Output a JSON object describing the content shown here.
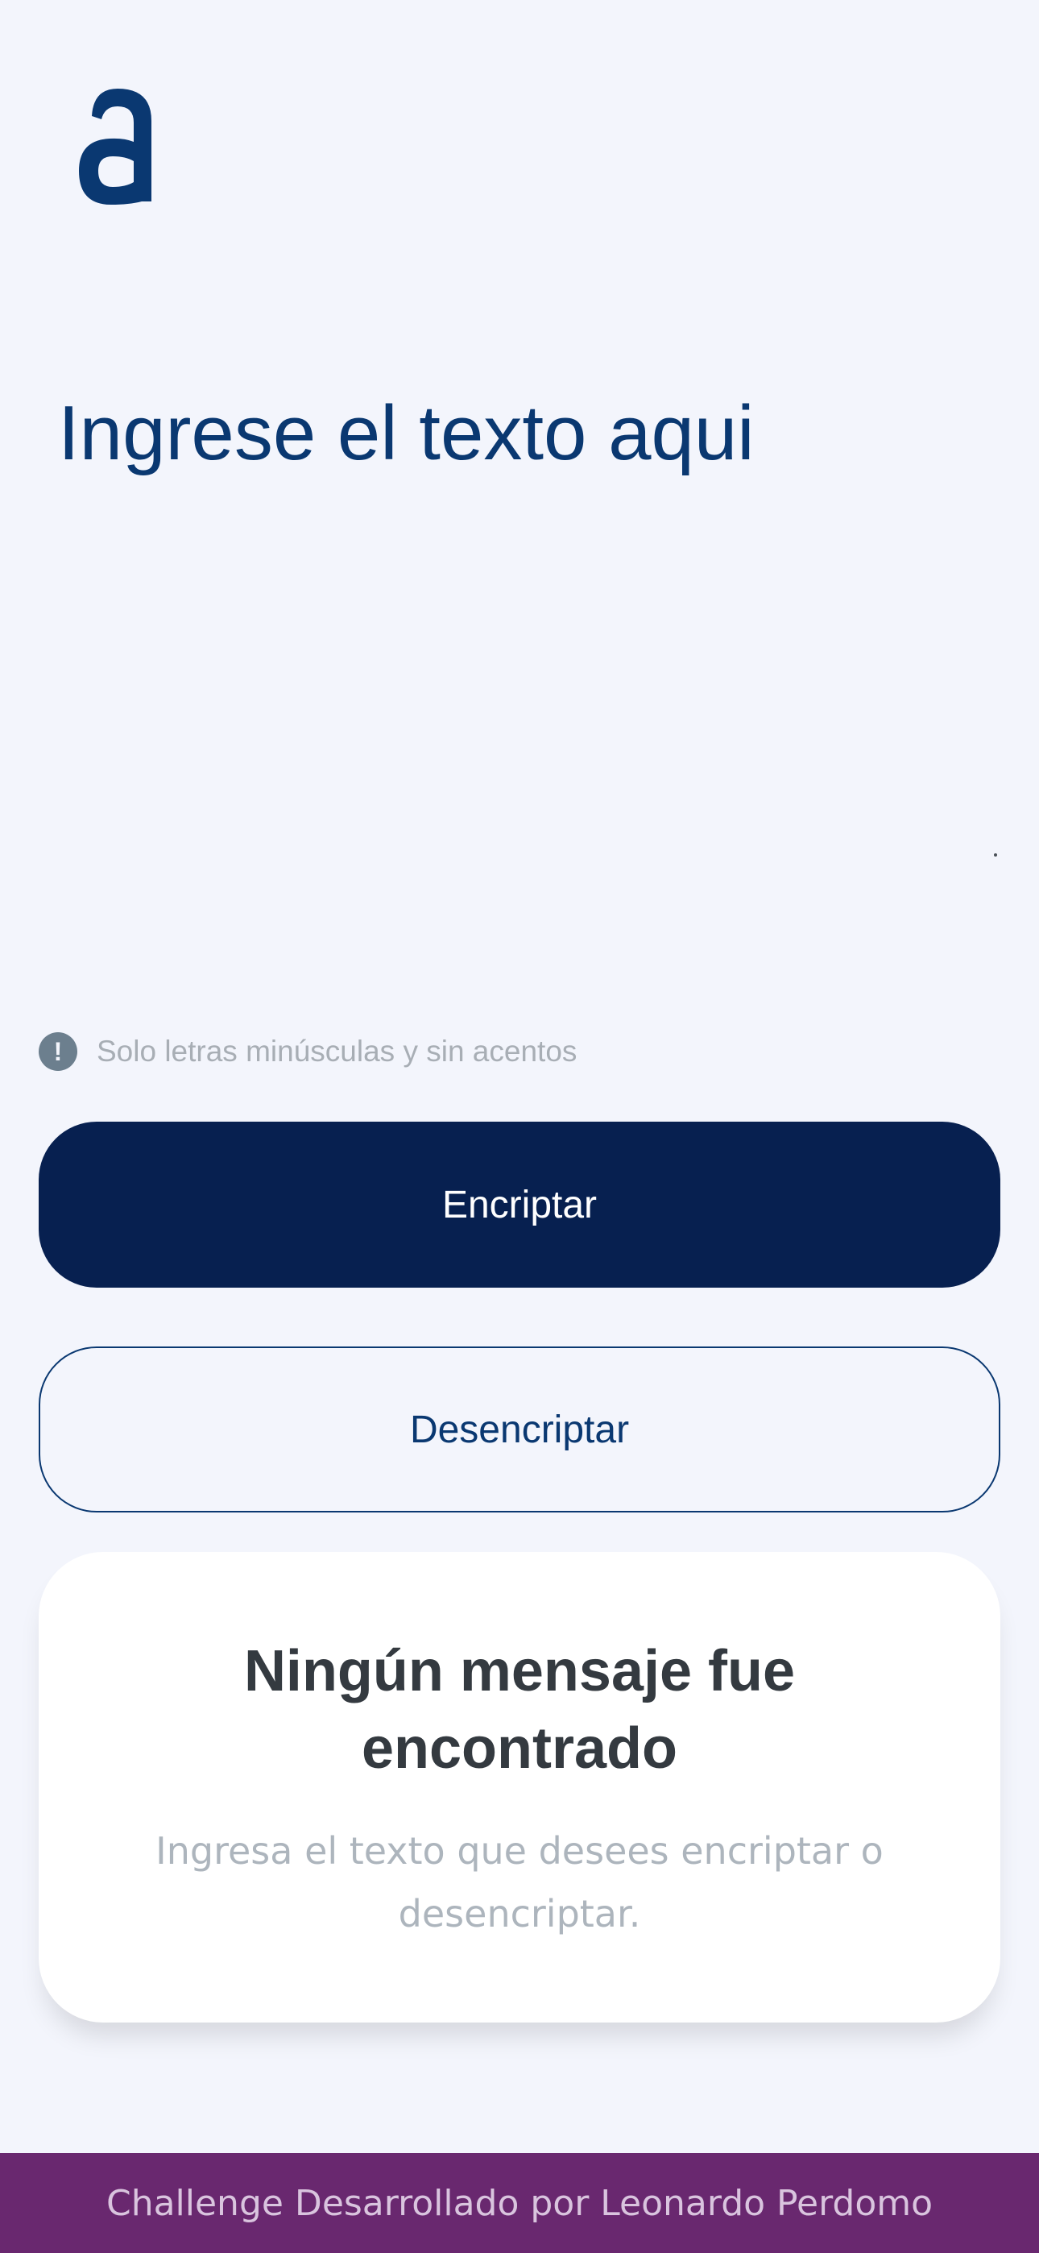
{
  "brand": {
    "logo_letter": "a",
    "logo_color": "#0a3871"
  },
  "input": {
    "placeholder": "Ingrese el texto aqui",
    "value": ""
  },
  "hint": {
    "icon": "exclamation-circle-icon",
    "text": "Solo letras minúsculas y sin acentos"
  },
  "buttons": {
    "encrypt_label": "Encriptar",
    "decrypt_label": "Desencriptar"
  },
  "output": {
    "title": "Ningún mensaje fue encontrado",
    "description": "Ingresa el texto que desees encriptar o desencriptar."
  },
  "footer": {
    "text": "Challenge Desarrollado por Leonardo Perdomo"
  },
  "colors": {
    "background": "#f3f5fc",
    "primary": "#072050",
    "text_primary": "#0a3871",
    "footer_bg": "#69286f"
  }
}
